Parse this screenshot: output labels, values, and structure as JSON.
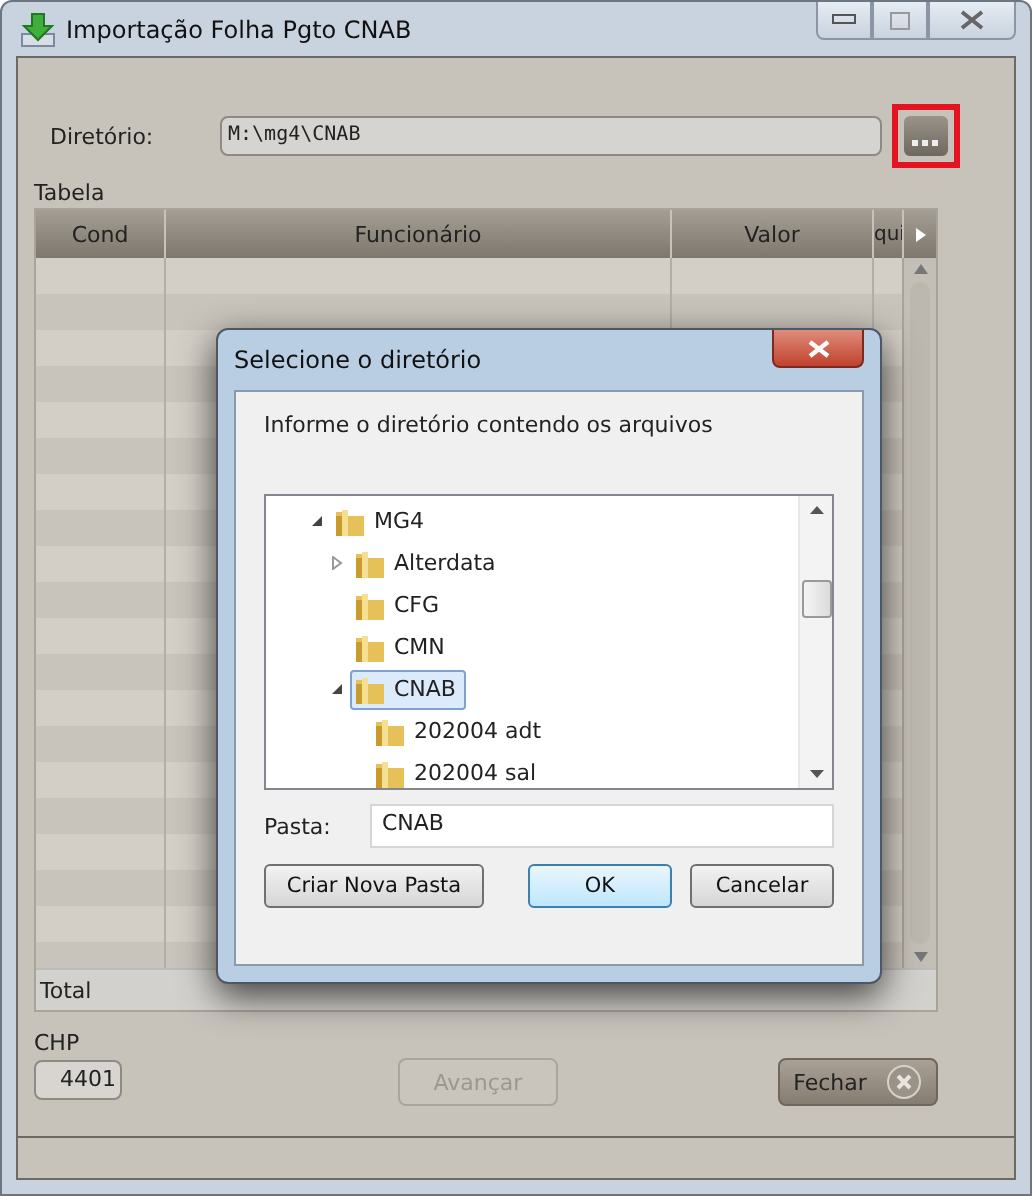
{
  "window": {
    "title": "Importação Folha Pgto CNAB"
  },
  "directory": {
    "label": "Diretório:",
    "value": "M:\\mg4\\CNAB",
    "browse_highlighted": true
  },
  "table": {
    "label": "Tabela",
    "columns": [
      "Cond",
      "Funcionário",
      "Valor",
      "qui"
    ],
    "total_label": "Total"
  },
  "chp": {
    "label": "CHP",
    "value": "4401"
  },
  "buttons": [
    {
      "label": "Avançar",
      "disabled": true,
      "kind": "next"
    },
    {
      "label": "Fechar",
      "disabled": false,
      "kind": "close"
    }
  ],
  "dialog": {
    "title": "Selecione o diretório",
    "prompt": "Informe o diretório contendo os arquivos",
    "tree": [
      {
        "label": "MG4",
        "expanded": true,
        "selected": false,
        "children": [
          {
            "label": "Alterdata",
            "expanded": false,
            "selected": false
          },
          {
            "label": "CFG",
            "selected": false
          },
          {
            "label": "CMN",
            "selected": false
          },
          {
            "label": "CNAB",
            "expanded": true,
            "selected": true,
            "children": [
              {
                "label": "202004 adt",
                "selected": false
              },
              {
                "label": "202004 sal",
                "selected": false
              }
            ]
          }
        ]
      }
    ],
    "folder_label": "Pasta:",
    "folder_value": "CNAB",
    "buttons": [
      {
        "label": "Criar Nova Pasta",
        "default": false
      },
      {
        "label": "OK",
        "default": true
      },
      {
        "label": "Cancelar",
        "default": false
      }
    ]
  }
}
